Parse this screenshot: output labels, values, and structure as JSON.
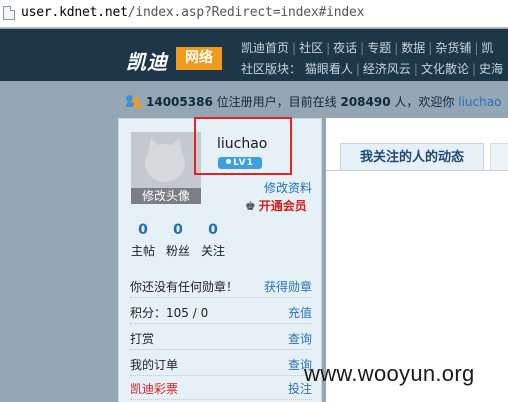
{
  "browser": {
    "url_host": "user.kdnet.net",
    "url_path": "/index.asp?Redirect=index#index"
  },
  "header": {
    "logo_text": "凯迪",
    "logo_box": "网络",
    "nav_row1": [
      "凯迪首页",
      "社区",
      "夜话",
      "专题",
      "数据",
      "杂货铺",
      "凯"
    ],
    "nav_row2_prefix": "社区版块：",
    "nav_row2": [
      "猫眼看人",
      "经济风云",
      "文化散论",
      "史海"
    ]
  },
  "stats": {
    "registered": "14005386",
    "registered_label": "位注册用户，目前在线",
    "online": "208490",
    "online_label": "人，欢迎你",
    "username": "liuchao"
  },
  "profile": {
    "avatar_caption": "修改头像",
    "username": "liuchao",
    "level": "LV1",
    "edit_profile": "修改资料",
    "open_vip": "开通会员",
    "counts": [
      {
        "num": "0",
        "label": "主帖"
      },
      {
        "num": "0",
        "label": "粉丝"
      },
      {
        "num": "0",
        "label": "关注"
      }
    ],
    "rows": [
      {
        "label": "你还没有任何勋章！",
        "action": "获得勋章"
      },
      {
        "label": "积分：105 / 0",
        "action": "充值"
      },
      {
        "label": "打赏",
        "action": "查询"
      },
      {
        "label": "我的订单",
        "action": "查询"
      },
      {
        "label": "凯迪彩票",
        "action": "投注"
      }
    ]
  },
  "panel": {
    "tab_active": "我关注的人的动态"
  },
  "watermark": "www.wooyun.org",
  "colors": {
    "header_bg": "#1e3748",
    "logo_orange": "#f09a1c",
    "link_blue": "#2a70b8",
    "alert_red": "#d02020",
    "highlight_box": "#e02424"
  }
}
